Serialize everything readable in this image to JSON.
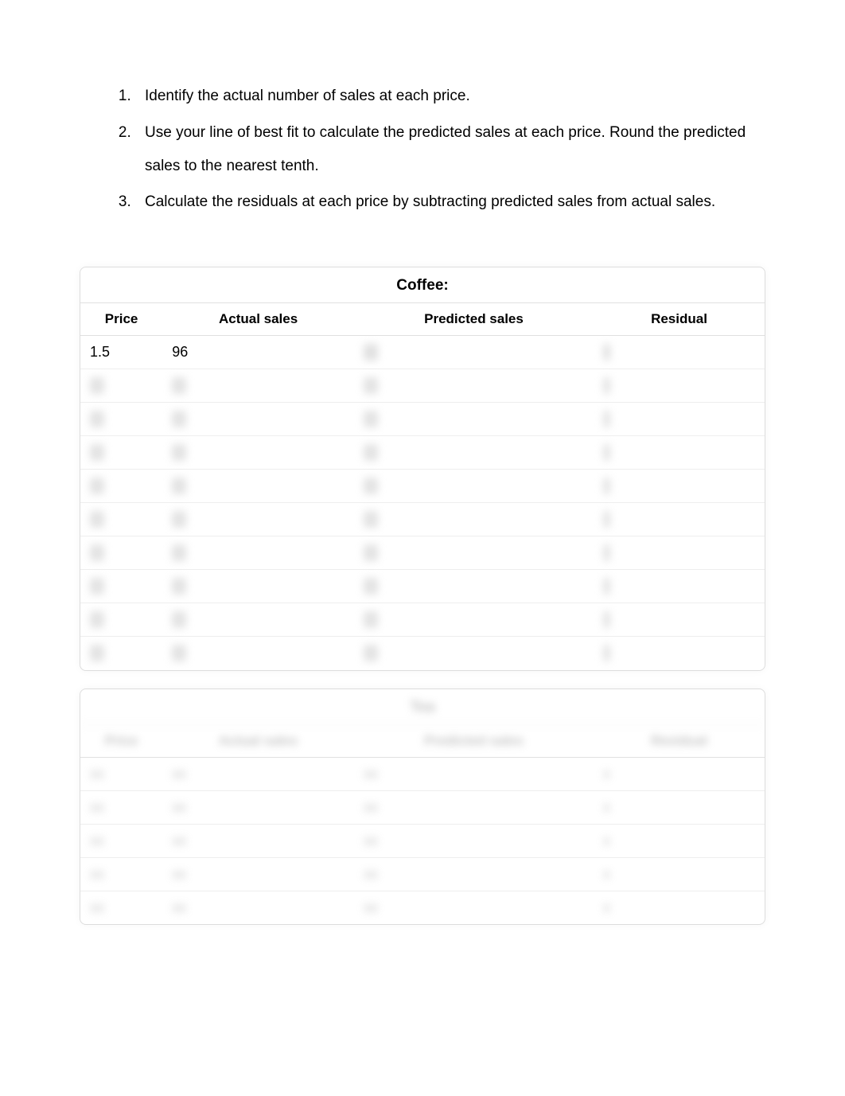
{
  "instructions": {
    "item1": "Identify the actual number of sales at each price.",
    "item2": "Use your line of best fit to calculate the predicted sales at each price. Round the predicted sales to the nearest tenth.",
    "item3": "Calculate the residuals at each price by subtracting predicted sales from actual sales."
  },
  "table1": {
    "title": "Coffee:",
    "headers": {
      "price": "Price",
      "actual": "Actual sales",
      "predicted": "Predicted sales",
      "residual": "Residual"
    },
    "rows": {
      "r0": {
        "price": "1.5",
        "actual": "96",
        "predicted": "",
        "residual": ""
      }
    }
  },
  "table2": {
    "headers": {
      "price": "Price",
      "actual": "Actual sales",
      "predicted": "Predicted sales",
      "residual": "Residual"
    }
  }
}
